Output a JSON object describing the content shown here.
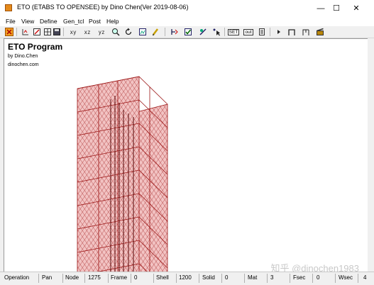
{
  "window": {
    "title": "ETO (ETABS TO OPENSEE) by Dino Chen(Ver 2019-08-06)",
    "minimize": "—",
    "maximize": "☐",
    "close": "✕"
  },
  "menu": [
    "File",
    "View",
    "Define",
    "Gen_tcl",
    "Post",
    "Help"
  ],
  "toolbar": {
    "view_xy": "xy",
    "view_xz": "xz",
    "view_yz": "yz",
    "set": "SET",
    "out": "out"
  },
  "canvas": {
    "program_title": "ETO Program",
    "author": "by Dino.Chen",
    "website": "dinochen.com"
  },
  "watermark": "知乎 @dinochen1983",
  "model_colors": {
    "shell_fill": "#f2c3c3",
    "mesh": "#9b1414",
    "frame": "#5a0a0a"
  },
  "status": {
    "operation_label": "Operation",
    "operation_value": "Pan",
    "node_label": "Node",
    "node_value": "1275",
    "frame_label": "Frame",
    "frame_value": "0",
    "shell_label": "Shell",
    "shell_value": "1200",
    "solid_label": "Solid",
    "solid_value": "0",
    "mat_label": "Mat",
    "mat_value": "3",
    "fsec_label": "Fsec",
    "fsec_value": "0",
    "wsec_label": "Wsec",
    "wsec_value": "4"
  }
}
